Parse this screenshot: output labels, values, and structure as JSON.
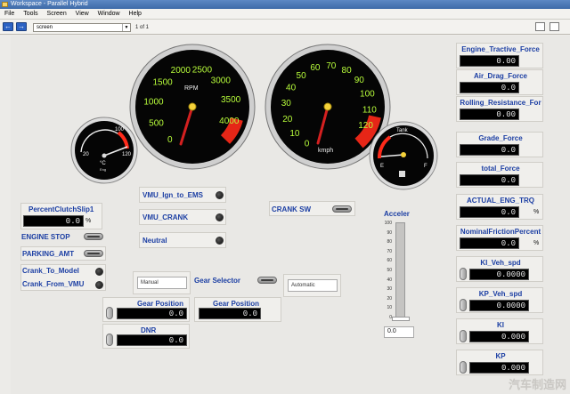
{
  "window": {
    "title": "Workspace - Parallel Hybrid"
  },
  "menu": [
    "File",
    "Tools",
    "Screen",
    "View",
    "Window",
    "Help"
  ],
  "toolbar": {
    "screen_value": "screen",
    "page_text": "1   of   1"
  },
  "gauges": {
    "temp": {
      "ticks": [
        "20",
        "100",
        "120"
      ],
      "unit": "°C",
      "sub": "Eng"
    },
    "rpm": {
      "ticks": [
        "0",
        "500",
        "1000",
        "1500",
        "2000",
        "2500",
        "3000",
        "3500",
        "4000"
      ],
      "unit": "RPM"
    },
    "speed": {
      "ticks": [
        "0",
        "10",
        "20",
        "30",
        "40",
        "50",
        "60",
        "70",
        "80",
        "90",
        "100",
        "110",
        "120"
      ],
      "unit": "kmph"
    },
    "tank": {
      "label": "Tank",
      "ticks": [
        "E",
        "F"
      ]
    }
  },
  "left": {
    "clutch_label": "PercentClutchSlip1",
    "clutch_value": "0.0",
    "clutch_unit": "%",
    "engine_stop": "ENGINE STOP",
    "parking": "PARKING_AMT",
    "crank_model": "Crank_To_Model",
    "crank_vmu": "Crank_From_VMU"
  },
  "middle": {
    "ign": "VMU_Ign_to_EMS",
    "crank": "VMU_CRANK",
    "neutral": "Neutral",
    "crank_sw": "CRANK SW",
    "manual": "Manual",
    "gear_selector": "Gear Selector",
    "automatic": "Automatic",
    "gear_pos1_label": "Gear Position",
    "gear_pos1_value": "0.0",
    "gear_pos2_label": "Gear Position",
    "gear_pos2_value": "0.0",
    "dnr_label": "DNR",
    "dnr_value": "0.0"
  },
  "acceler": {
    "label": "Acceler",
    "ticks": [
      "100",
      "90",
      "80",
      "70",
      "60",
      "50",
      "40",
      "30",
      "20",
      "10",
      "0"
    ],
    "value": "0.0"
  },
  "right": [
    {
      "label": "Engine_Tractive_Force",
      "value": "0.00",
      "unit": ""
    },
    {
      "label": "Air_Drag_Force",
      "value": "0.0",
      "unit": ""
    },
    {
      "label": "Rolling_Resistance_For",
      "value": "0.00",
      "unit": ""
    },
    {
      "label": "Grade_Force",
      "value": "0.0",
      "unit": ""
    },
    {
      "label": "total_Force",
      "value": "0.0",
      "unit": ""
    },
    {
      "label": "ACTUAL_ENG_TRQ",
      "value": "0.0",
      "unit": "%"
    },
    {
      "label": "NominalFrictionPercent",
      "value": "0.0",
      "unit": "%"
    },
    {
      "label": "KI_Veh_spd",
      "value": "0.0000",
      "unit": ""
    },
    {
      "label": "KP_Veh_spd",
      "value": "0.0000",
      "unit": ""
    },
    {
      "label": "KI",
      "value": "0.000",
      "unit": ""
    },
    {
      "label": "KP",
      "value": "0.000",
      "unit": ""
    }
  ],
  "colors": {
    "label_blue": "#1b3ea3",
    "needle": "#d42020",
    "gauge_green": "#b9ff3b",
    "redzone": "#ff2a1a"
  }
}
